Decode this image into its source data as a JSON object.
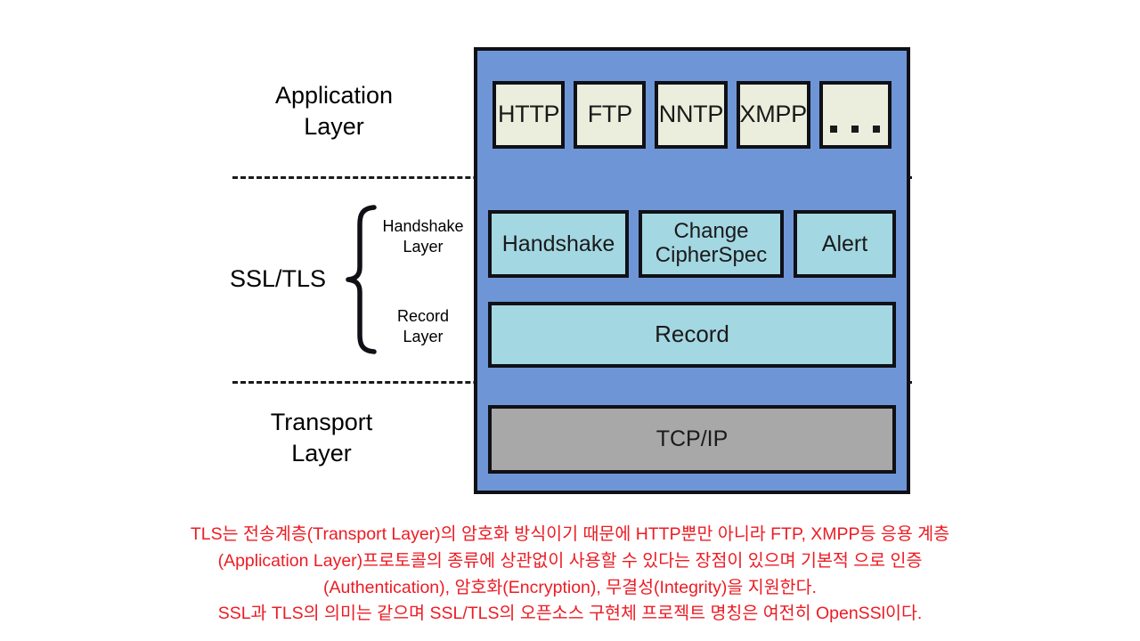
{
  "diagram": {
    "title": "SSL/TLS protocol stack",
    "colors": {
      "stack_fill": "#6e96d6",
      "application_box_fill": "#ebeedd",
      "tls_box_fill": "#a3d7e2",
      "transport_box_fill": "#a8a8a8",
      "outline": "#101016",
      "caption_text": "#ec1c24"
    },
    "left_labels": {
      "application": "Application\nLayer",
      "ssltls": "SSL/TLS",
      "transport": "Transport\nLayer",
      "handshake_sub": "Handshake\nLayer",
      "record_sub": "Record\nLayer"
    },
    "application_layer": {
      "boxes": [
        {
          "label": "HTTP"
        },
        {
          "label": "FTP"
        },
        {
          "label": "NNTP"
        },
        {
          "label": "XMPP"
        },
        {
          "label": "..."
        }
      ]
    },
    "ssl_tls_layer": {
      "handshake_row": [
        {
          "label": "Handshake"
        },
        {
          "label": "Change\nCipherSpec"
        },
        {
          "label": "Alert"
        }
      ],
      "record_row": [
        {
          "label": "Record"
        }
      ]
    },
    "transport_layer": {
      "boxes": [
        {
          "label": "TCP/IP"
        }
      ]
    },
    "caption": {
      "line1": "TLS는 전송계층(Transport Layer)의 암호화 방식이기 때문에 HTTP뿐만 아니라 FTP, XMPP등 응용 계층",
      "line2": "(Application Layer)프로토콜의 종류에 상관없이 사용할 수 있다는 장점이 있으며 기본적 으로 인증",
      "line3": "(Authentication), 암호화(Encryption), 무결성(Integrity)을 지원한다.",
      "line4": "SSL과 TLS의 의미는 같으며 SSL/TLS의 오픈소스 구현체 프로젝트 명칭은 여전히 OpenSSl이다."
    }
  }
}
